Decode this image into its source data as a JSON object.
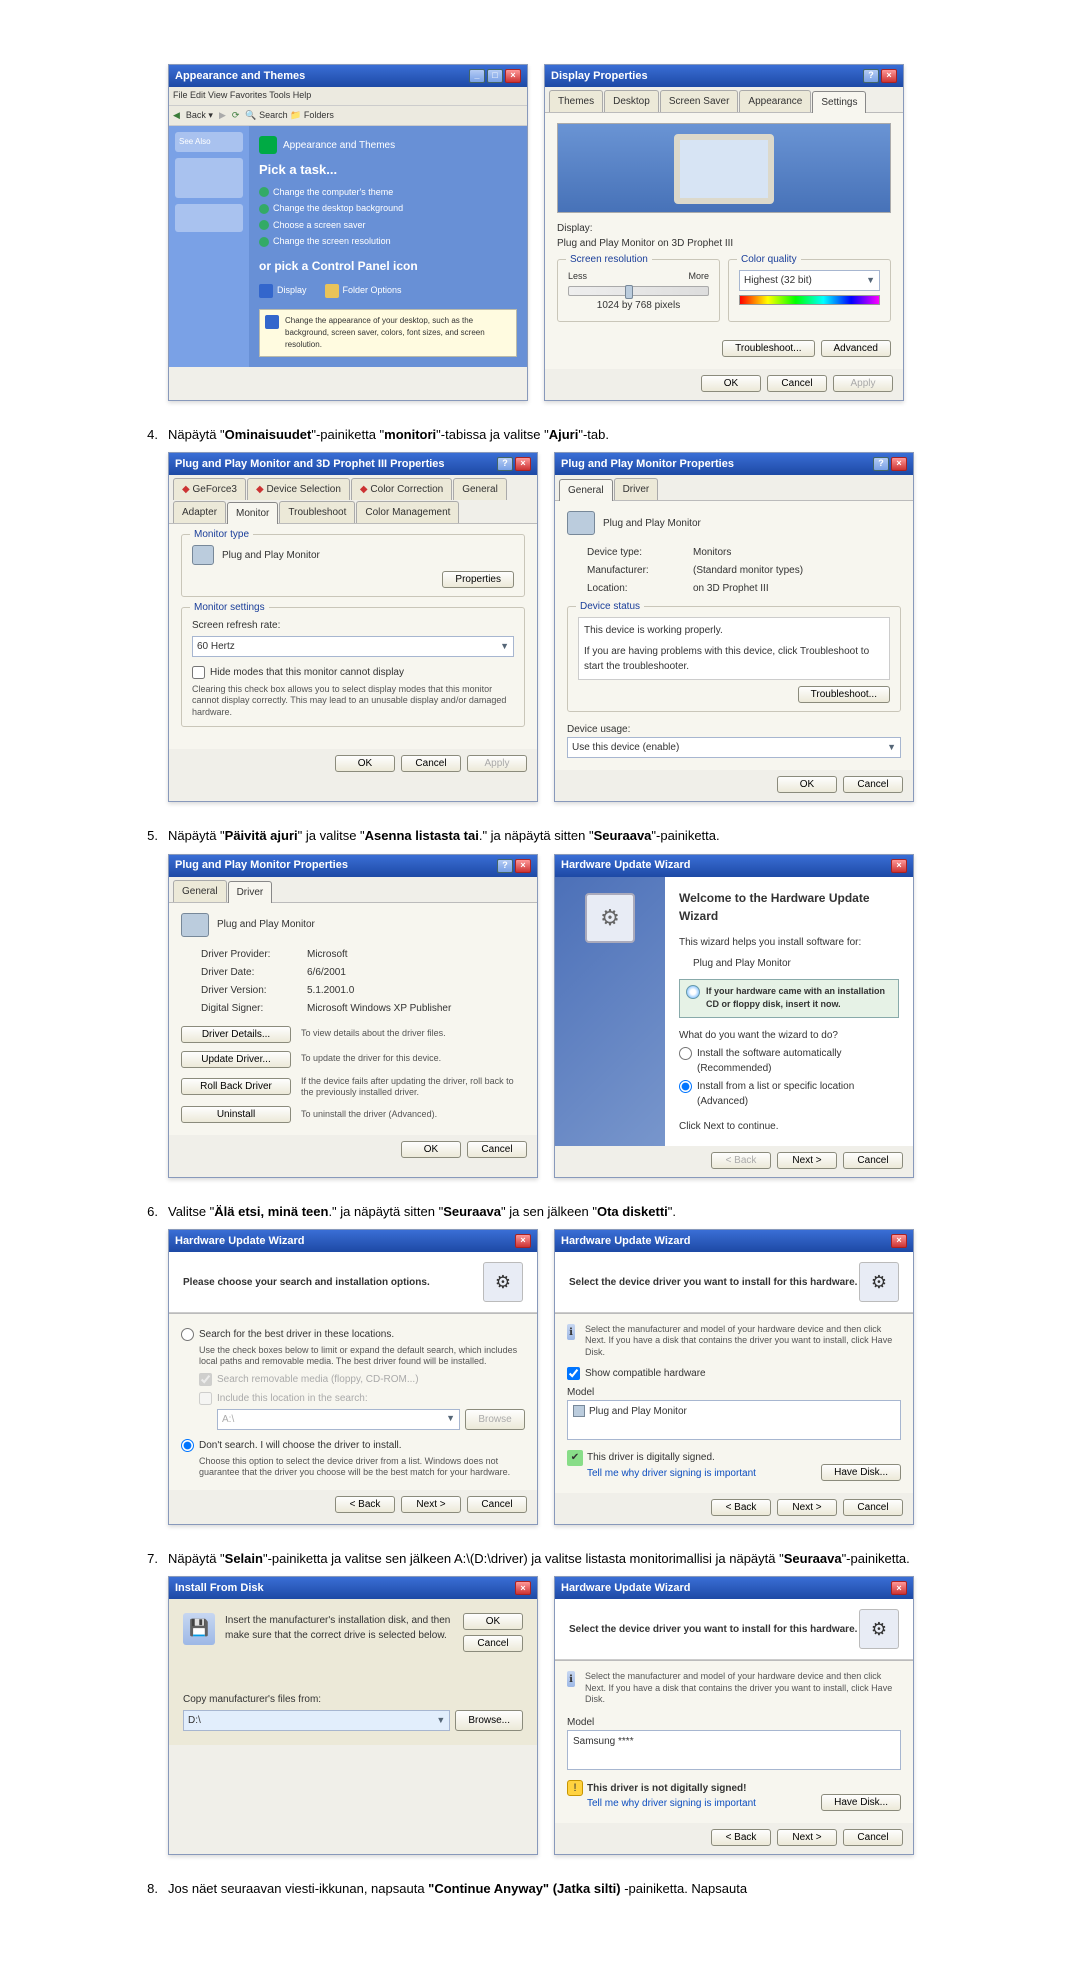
{
  "steps": {
    "s4": {
      "num": "4.",
      "pre": "Näpäytä \"",
      "b1": "Ominaisuudet",
      "mid1": "\"-painiketta \"",
      "b2": "monitori",
      "mid2": "\"-tabissa ja valitse \"",
      "b3": "Ajuri",
      "post": "\"-tab."
    },
    "s5": {
      "num": "5.",
      "pre": "Näpäytä \"",
      "b1": "Päivitä ajuri",
      "mid1": "\" ja valitse \"",
      "b2": "Asenna listasta tai",
      "mid2": ".\" ja näpäytä sitten \"",
      "b3": "Seuraava",
      "post": "\"-painiketta."
    },
    "s6": {
      "num": "6.",
      "pre": "Valitse \"",
      "b1": "Älä etsi, minä teen",
      "mid1": ".\" ja näpäytä sitten \"",
      "b2": "Seuraava",
      "mid2": "\" ja sen jälkeen \"",
      "b3": "Ota disketti",
      "post": "\"."
    },
    "s7": {
      "num": "7.",
      "pre": "Näpäytä \"",
      "b1": "Selain",
      "mid1": "\"-painiketta ja valitse sen jälkeen A:\\(D:\\driver) ja valitse listasta monitorimallisi ja näpäytä \"",
      "b2": "Seuraava",
      "post": "\"-painiketta."
    },
    "s8": {
      "num": "8.",
      "text_a": "Jos näet seuraavan viesti-ikkunan, napsauta ",
      "b1": "\"Continue Anyway\" (Jatka silti)",
      "text_b": " -painiketta. Napsauta"
    }
  },
  "cp": {
    "title": "Appearance and Themes",
    "sidebar": {
      "seealso": "See Also"
    },
    "pick": "Pick a task...",
    "t1": "Change the computer's theme",
    "t2": "Change the desktop background",
    "t3": "Choose a screen saver",
    "t4": "Change the screen resolution",
    "or": "or pick a Control Panel icon",
    "i1": "Display",
    "i2": "Folder Options"
  },
  "dispProps": {
    "title": "Display Properties",
    "tabs": {
      "themes": "Themes",
      "desktop": "Desktop",
      "screensaver": "Screen Saver",
      "appearance": "Appearance",
      "settings": "Settings"
    },
    "displayLabel": "Display:",
    "displayName": "Plug and Play Monitor on 3D Prophet III",
    "resGroup": "Screen resolution",
    "less": "Less",
    "more": "More",
    "resValue": "1024 by 768 pixels",
    "colorGroup": "Color quality",
    "colorValue": "Highest (32 bit)",
    "troubleshoot": "Troubleshoot...",
    "advanced": "Advanced",
    "ok": "OK",
    "cancel": "Cancel",
    "apply": "Apply"
  },
  "monProps3d": {
    "title": "Plug and Play Monitor and 3D Prophet III Properties",
    "tabs": {
      "general": "General",
      "adapter": "Adapter",
      "monitor": "Monitor",
      "troubleshoot": "Troubleshoot",
      "colormgmt": "Color Management",
      "geforce": "GeForce3",
      "devsel": "Device Selection",
      "colorcorr": "Color Correction"
    },
    "typeGroup": "Monitor type",
    "monitorName": "Plug and Play Monitor",
    "properties": "Properties",
    "settingsGroup": "Monitor settings",
    "refreshLabel": "Screen refresh rate:",
    "refreshValue": "60 Hertz",
    "hideModes": "Hide modes that this monitor cannot display",
    "hideHelp": "Clearing this check box allows you to select display modes that this monitor cannot display correctly. This may lead to an unusable display and/or damaged hardware.",
    "ok": "OK",
    "cancel": "Cancel",
    "apply": "Apply"
  },
  "pnpGeneral": {
    "title": "Plug and Play Monitor Properties",
    "tabs": {
      "general": "General",
      "driver": "Driver"
    },
    "name": "Plug and Play Monitor",
    "devType": "Device type:",
    "devTypeVal": "Monitors",
    "mfr": "Manufacturer:",
    "mfrVal": "(Standard monitor types)",
    "loc": "Location:",
    "locVal": "on 3D Prophet III",
    "statusGroup": "Device status",
    "statusText": "This device is working properly.",
    "statusHelp": "If you are having problems with this device, click Troubleshoot to start the troubleshooter.",
    "troubleshoot": "Troubleshoot...",
    "usage": "Device usage:",
    "usageVal": "Use this device (enable)",
    "ok": "OK",
    "cancel": "Cancel"
  },
  "pnpDriver": {
    "title": "Plug and Play Monitor Properties",
    "tabs": {
      "general": "General",
      "driver": "Driver"
    },
    "name": "Plug and Play Monitor",
    "provider": "Driver Provider:",
    "providerVal": "Microsoft",
    "date": "Driver Date:",
    "dateVal": "6/6/2001",
    "version": "Driver Version:",
    "versionVal": "5.1.2001.0",
    "signer": "Digital Signer:",
    "signerVal": "Microsoft Windows XP Publisher",
    "details": "Driver Details...",
    "detailsHelp": "To view details about the driver files.",
    "update": "Update Driver...",
    "updateHelp": "To update the driver for this device.",
    "rollback": "Roll Back Driver",
    "rollbackHelp": "If the device fails after updating the driver, roll back to the previously installed driver.",
    "uninstall": "Uninstall",
    "uninstallHelp": "To uninstall the driver (Advanced).",
    "ok": "OK",
    "cancel": "Cancel"
  },
  "wizardWelcome": {
    "title": "Hardware Update Wizard",
    "heading": "Welcome to the Hardware Update Wizard",
    "helps": "This wizard helps you install software for:",
    "device": "Plug and Play Monitor",
    "cdbox": "If your hardware came with an installation CD or floppy disk, insert it now.",
    "what": "What do you want the wizard to do?",
    "opt1": "Install the software automatically (Recommended)",
    "opt2": "Install from a list or specific location (Advanced)",
    "cont": "Click Next to continue.",
    "back": "< Back",
    "next": "Next >",
    "cancel": "Cancel"
  },
  "wizardSearch": {
    "title": "Hardware Update Wizard",
    "header": "Please choose your search and installation options.",
    "opt1": "Search for the best driver in these locations.",
    "opt1help": "Use the check boxes below to limit or expand the default search, which includes local paths and removable media. The best driver found will be installed.",
    "chk1": "Search removable media (floppy, CD-ROM...)",
    "chk2": "Include this location in the search:",
    "loc": "A:\\",
    "browse": "Browse",
    "opt2": "Don't search. I will choose the driver to install.",
    "opt2help": "Choose this option to select the device driver from a list. Windows does not guarantee that the driver you choose will be the best match for your hardware.",
    "back": "< Back",
    "next": "Next >",
    "cancel": "Cancel"
  },
  "wizardSelect": {
    "title": "Hardware Update Wizard",
    "header": "Select the device driver you want to install for this hardware.",
    "help": "Select the manufacturer and model of your hardware device and then click Next. If you have a disk that contains the driver you want to install, click Have Disk.",
    "showCompat": "Show compatible hardware",
    "modelLabel": "Model",
    "model": "Plug and Play Monitor",
    "signed": "This driver is digitally signed.",
    "tellwhy": "Tell me why driver signing is important",
    "havedisk": "Have Disk...",
    "back": "< Back",
    "next": "Next >",
    "cancel": "Cancel"
  },
  "installDisk": {
    "title": "Install From Disk",
    "text": "Insert the manufacturer's installation disk, and then make sure that the correct drive is selected below.",
    "ok": "OK",
    "cancel": "Cancel",
    "copy": "Copy manufacturer's files from:",
    "path": "D:\\",
    "browse": "Browse..."
  },
  "wizardSelect2": {
    "title": "Hardware Update Wizard",
    "header": "Select the device driver you want to install for this hardware.",
    "help": "Select the manufacturer and model of your hardware device and then click Next. If you have a disk that contains the driver you want to install, click Have Disk.",
    "modelLabel": "Model",
    "model": "Samsung ****",
    "notsigned": "This driver is not digitally signed!",
    "tellwhy": "Tell me why driver signing is important",
    "havedisk": "Have Disk...",
    "back": "< Back",
    "next": "Next >",
    "cancel": "Cancel"
  }
}
